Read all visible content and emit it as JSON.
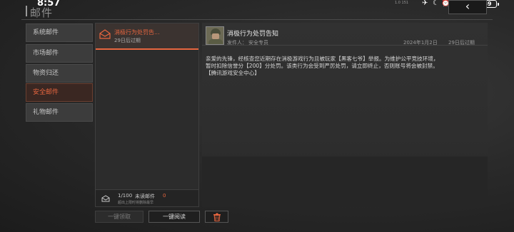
{
  "status_bar": {
    "time": "8:57",
    "net_speed": "1.0 151",
    "battery": "69"
  },
  "header": {
    "title": "邮件",
    "back_icon": "chevron-left-icon"
  },
  "sidebar": {
    "items": [
      {
        "label": "系统邮件",
        "active": false
      },
      {
        "label": "市场邮件",
        "active": false
      },
      {
        "label": "物资归还",
        "active": false
      },
      {
        "label": "安全邮件",
        "active": true
      },
      {
        "label": "礼物邮件",
        "active": false
      }
    ]
  },
  "mail_list": {
    "items": [
      {
        "title": "消极行为处罚告...",
        "expiry": "29日后过期",
        "icon": "envelope-open-icon"
      }
    ],
    "footer": {
      "count": "1/100",
      "unread_label": "未读邮件",
      "unread_count": "0",
      "note": "超出上限时将删除最早"
    }
  },
  "message": {
    "title": "消极行为处罚告知",
    "sender_label": "发件人：",
    "sender": "安全专员",
    "date": "2024年1月2日",
    "expiry": "29日后过期",
    "body_lines": [
      "亲爱的先锋，经核查您近期存在消极游戏行为且被玩家【黑客七爷】举报。为维护公平竞技环境，",
      "暂时扣除信誉分【200】分处罚。该类行为会受到严厉处罚，请立即终止，否则账号将会被封禁。",
      "【腾讯游戏安全中心】"
    ]
  },
  "actions": {
    "claim_all": "一键领取",
    "read_all": "一键阅读",
    "delete_icon": "trash-icon"
  },
  "colors": {
    "accent": "#e8663f",
    "background": "#262626"
  }
}
